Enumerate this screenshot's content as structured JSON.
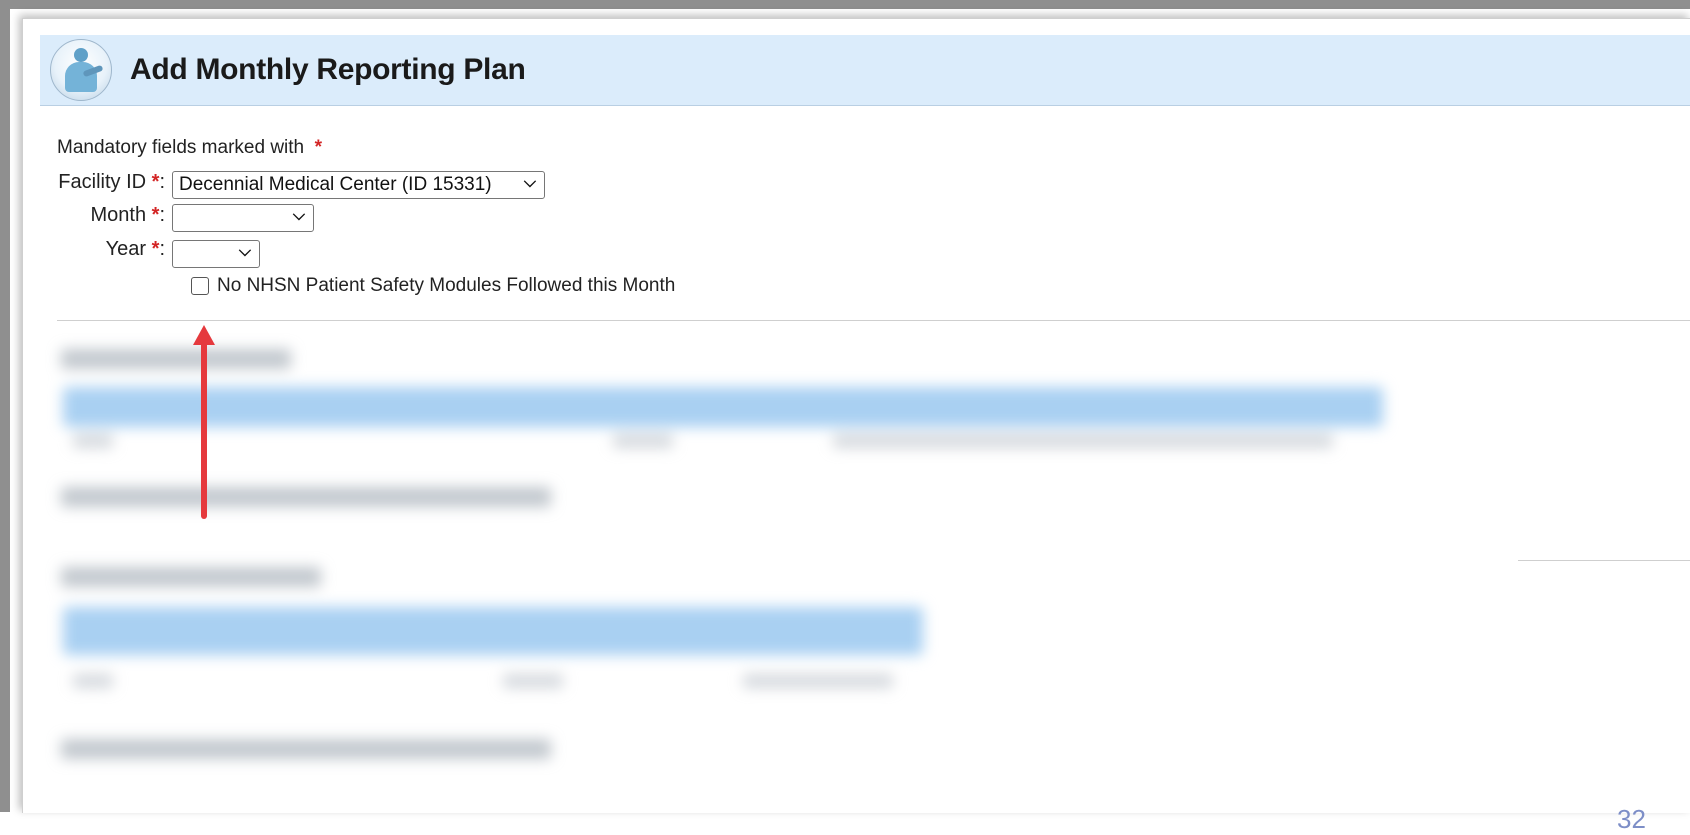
{
  "header": {
    "title": "Add Monthly Reporting Plan",
    "logo_icon": "clinician-icon"
  },
  "form": {
    "mandatory_note": "Mandatory fields marked with",
    "required_mark": "*",
    "facility": {
      "label": "Facility ID",
      "value": "Decennial Medical Center (ID 15331)"
    },
    "month": {
      "label": "Month",
      "value": ""
    },
    "year": {
      "label": "Year",
      "value": ""
    },
    "no_modules_checkbox": {
      "label": "No NHSN Patient Safety Modules Followed this Month",
      "checked": false
    }
  },
  "annotation": {
    "arrow_color": "#e5393d"
  },
  "slide": {
    "page_number": "32"
  },
  "colors": {
    "header_bg": "#dbecfb",
    "required": "#d32525",
    "blurred_header": "#a9d0f2"
  }
}
